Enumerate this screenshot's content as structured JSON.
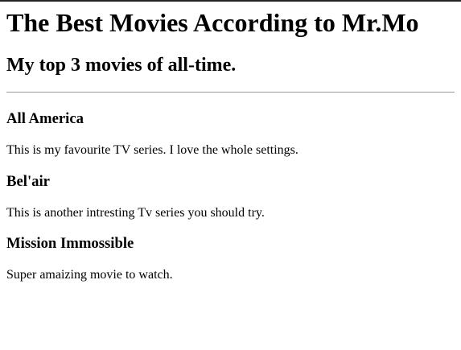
{
  "page": {
    "title": "The Best Movies According to Mr.Mo",
    "subtitle": "My top 3 movies of all-time."
  },
  "movies": [
    {
      "title": "All America",
      "description": "This is my favourite TV series. I love the whole settings."
    },
    {
      "title": "Bel'air",
      "description": "This is another intresting Tv series you should try."
    },
    {
      "title": "Mission Immossible",
      "description": "Super amaizing movie to watch."
    }
  ]
}
